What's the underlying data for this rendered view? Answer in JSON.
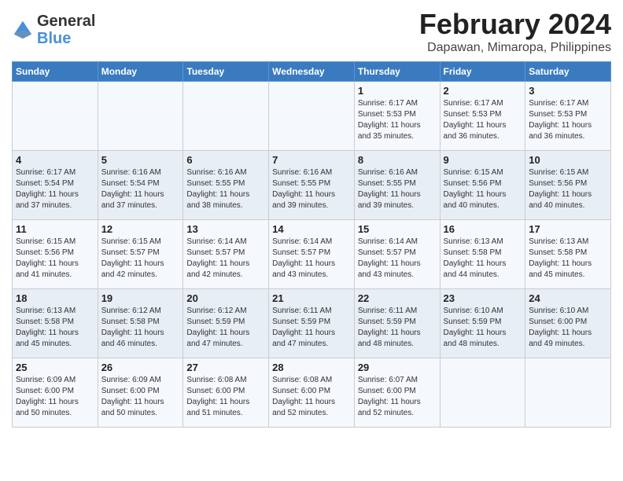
{
  "header": {
    "logo_line1": "General",
    "logo_line2": "Blue",
    "month": "February 2024",
    "location": "Dapawan, Mimaropa, Philippines"
  },
  "days_of_week": [
    "Sunday",
    "Monday",
    "Tuesday",
    "Wednesday",
    "Thursday",
    "Friday",
    "Saturday"
  ],
  "weeks": [
    [
      {
        "day": "",
        "info": ""
      },
      {
        "day": "",
        "info": ""
      },
      {
        "day": "",
        "info": ""
      },
      {
        "day": "",
        "info": ""
      },
      {
        "day": "1",
        "info": "Sunrise: 6:17 AM\nSunset: 5:53 PM\nDaylight: 11 hours\nand 35 minutes."
      },
      {
        "day": "2",
        "info": "Sunrise: 6:17 AM\nSunset: 5:53 PM\nDaylight: 11 hours\nand 36 minutes."
      },
      {
        "day": "3",
        "info": "Sunrise: 6:17 AM\nSunset: 5:53 PM\nDaylight: 11 hours\nand 36 minutes."
      }
    ],
    [
      {
        "day": "4",
        "info": "Sunrise: 6:17 AM\nSunset: 5:54 PM\nDaylight: 11 hours\nand 37 minutes."
      },
      {
        "day": "5",
        "info": "Sunrise: 6:16 AM\nSunset: 5:54 PM\nDaylight: 11 hours\nand 37 minutes."
      },
      {
        "day": "6",
        "info": "Sunrise: 6:16 AM\nSunset: 5:55 PM\nDaylight: 11 hours\nand 38 minutes."
      },
      {
        "day": "7",
        "info": "Sunrise: 6:16 AM\nSunset: 5:55 PM\nDaylight: 11 hours\nand 39 minutes."
      },
      {
        "day": "8",
        "info": "Sunrise: 6:16 AM\nSunset: 5:55 PM\nDaylight: 11 hours\nand 39 minutes."
      },
      {
        "day": "9",
        "info": "Sunrise: 6:15 AM\nSunset: 5:56 PM\nDaylight: 11 hours\nand 40 minutes."
      },
      {
        "day": "10",
        "info": "Sunrise: 6:15 AM\nSunset: 5:56 PM\nDaylight: 11 hours\nand 40 minutes."
      }
    ],
    [
      {
        "day": "11",
        "info": "Sunrise: 6:15 AM\nSunset: 5:56 PM\nDaylight: 11 hours\nand 41 minutes."
      },
      {
        "day": "12",
        "info": "Sunrise: 6:15 AM\nSunset: 5:57 PM\nDaylight: 11 hours\nand 42 minutes."
      },
      {
        "day": "13",
        "info": "Sunrise: 6:14 AM\nSunset: 5:57 PM\nDaylight: 11 hours\nand 42 minutes."
      },
      {
        "day": "14",
        "info": "Sunrise: 6:14 AM\nSunset: 5:57 PM\nDaylight: 11 hours\nand 43 minutes."
      },
      {
        "day": "15",
        "info": "Sunrise: 6:14 AM\nSunset: 5:57 PM\nDaylight: 11 hours\nand 43 minutes."
      },
      {
        "day": "16",
        "info": "Sunrise: 6:13 AM\nSunset: 5:58 PM\nDaylight: 11 hours\nand 44 minutes."
      },
      {
        "day": "17",
        "info": "Sunrise: 6:13 AM\nSunset: 5:58 PM\nDaylight: 11 hours\nand 45 minutes."
      }
    ],
    [
      {
        "day": "18",
        "info": "Sunrise: 6:13 AM\nSunset: 5:58 PM\nDaylight: 11 hours\nand 45 minutes."
      },
      {
        "day": "19",
        "info": "Sunrise: 6:12 AM\nSunset: 5:58 PM\nDaylight: 11 hours\nand 46 minutes."
      },
      {
        "day": "20",
        "info": "Sunrise: 6:12 AM\nSunset: 5:59 PM\nDaylight: 11 hours\nand 47 minutes."
      },
      {
        "day": "21",
        "info": "Sunrise: 6:11 AM\nSunset: 5:59 PM\nDaylight: 11 hours\nand 47 minutes."
      },
      {
        "day": "22",
        "info": "Sunrise: 6:11 AM\nSunset: 5:59 PM\nDaylight: 11 hours\nand 48 minutes."
      },
      {
        "day": "23",
        "info": "Sunrise: 6:10 AM\nSunset: 5:59 PM\nDaylight: 11 hours\nand 48 minutes."
      },
      {
        "day": "24",
        "info": "Sunrise: 6:10 AM\nSunset: 6:00 PM\nDaylight: 11 hours\nand 49 minutes."
      }
    ],
    [
      {
        "day": "25",
        "info": "Sunrise: 6:09 AM\nSunset: 6:00 PM\nDaylight: 11 hours\nand 50 minutes."
      },
      {
        "day": "26",
        "info": "Sunrise: 6:09 AM\nSunset: 6:00 PM\nDaylight: 11 hours\nand 50 minutes."
      },
      {
        "day": "27",
        "info": "Sunrise: 6:08 AM\nSunset: 6:00 PM\nDaylight: 11 hours\nand 51 minutes."
      },
      {
        "day": "28",
        "info": "Sunrise: 6:08 AM\nSunset: 6:00 PM\nDaylight: 11 hours\nand 52 minutes."
      },
      {
        "day": "29",
        "info": "Sunrise: 6:07 AM\nSunset: 6:00 PM\nDaylight: 11 hours\nand 52 minutes."
      },
      {
        "day": "",
        "info": ""
      },
      {
        "day": "",
        "info": ""
      }
    ]
  ]
}
